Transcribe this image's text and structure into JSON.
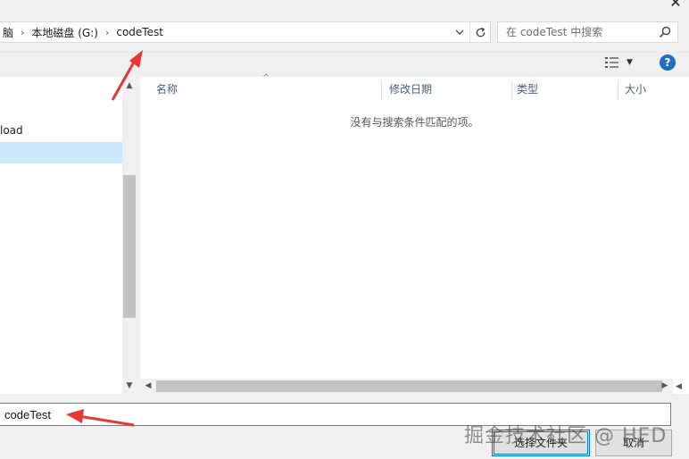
{
  "window": {
    "close_glyph": "✕"
  },
  "address_bar": {
    "crumbs": [
      "脑",
      "本地磁盘 (G:)",
      "codeTest"
    ]
  },
  "search": {
    "placeholder": "在 codeTest 中搜索"
  },
  "nav": {
    "items": [
      {
        "label": "load",
        "selected": false
      },
      {
        "label": "",
        "selected": true
      }
    ]
  },
  "columns": [
    "名称",
    "修改日期",
    "类型",
    "大小"
  ],
  "list": {
    "empty_message": "没有与搜索条件匹配的项。"
  },
  "folder_input": {
    "value": "codeTest"
  },
  "buttons": {
    "select_folder": "选择文件夹",
    "cancel": "取消"
  },
  "watermark": "掘金技术社区 @ HED",
  "icons": {
    "search": "magnifier-icon",
    "refresh": "refresh-icon",
    "view": "view-options-icon",
    "help": "help-icon"
  },
  "colors": {
    "selection": "#cce8ff",
    "accent": "#0078d7",
    "help": "#1e6fc1",
    "annotation_arrow": "#e53935"
  }
}
